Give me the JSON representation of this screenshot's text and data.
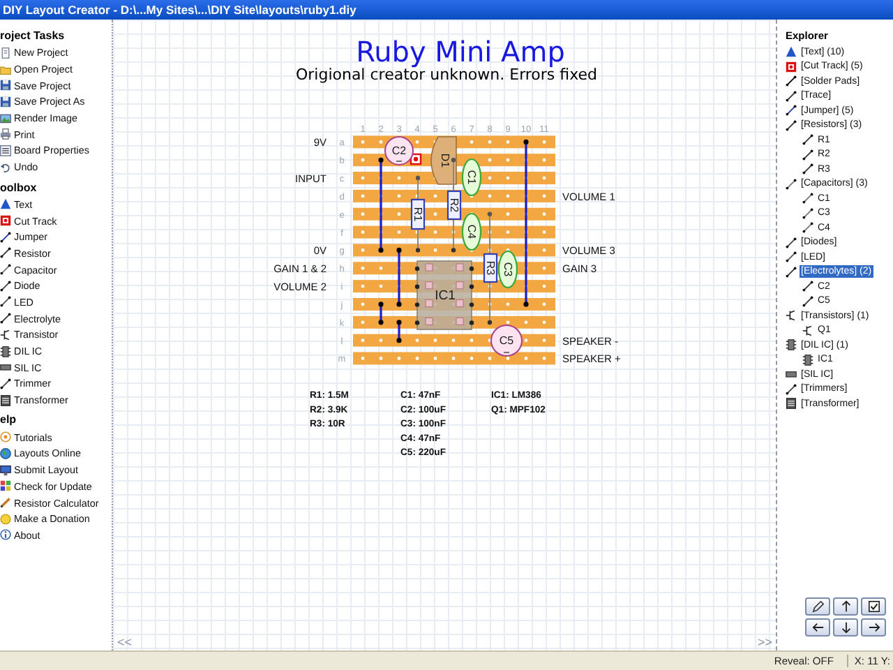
{
  "window": {
    "title": "DIY Layout Creator - D:\\...My Sites\\...\\DIY Site\\layouts\\ruby1.diy"
  },
  "sidebar": {
    "sections": [
      {
        "title": "roject Tasks",
        "items": [
          {
            "label": "New Project",
            "kind": "new"
          },
          {
            "label": "Open Project",
            "kind": "open"
          },
          {
            "label": "Save Project",
            "kind": "save"
          },
          {
            "label": "Save Project As",
            "kind": "save_as"
          },
          {
            "label": "Render Image",
            "kind": "render"
          },
          {
            "label": "Print",
            "kind": "print"
          },
          {
            "label": "Board Properties",
            "kind": "properties"
          },
          {
            "label": "Undo",
            "kind": "undo"
          }
        ]
      },
      {
        "title": "oolbox",
        "items": [
          {
            "label": "Text",
            "kind": "text"
          },
          {
            "label": "Cut Track",
            "kind": "cut_track"
          },
          {
            "label": "Jumper",
            "kind": "jumper"
          },
          {
            "label": "Resistor",
            "kind": "resistor"
          },
          {
            "label": "Capacitor",
            "kind": "capacitor"
          },
          {
            "label": "Diode",
            "kind": "diode"
          },
          {
            "label": "LED",
            "kind": "led"
          },
          {
            "label": "Electrolyte",
            "kind": "electrolyte"
          },
          {
            "label": "Transistor",
            "kind": "transistor"
          },
          {
            "label": "DIL IC",
            "kind": "dil"
          },
          {
            "label": "SIL IC",
            "kind": "sil"
          },
          {
            "label": "Trimmer",
            "kind": "trimmer"
          },
          {
            "label": "Transformer",
            "kind": "transformer"
          }
        ]
      },
      {
        "title": "elp",
        "items": [
          {
            "label": "Tutorials",
            "kind": "tutorials"
          },
          {
            "label": "Layouts Online",
            "kind": "online"
          },
          {
            "label": "Submit Layout",
            "kind": "submit"
          },
          {
            "label": "Check for Update",
            "kind": "update"
          },
          {
            "label": "Resistor Calculator",
            "kind": "calculator"
          },
          {
            "label": "Make a Donation",
            "kind": "donate"
          },
          {
            "label": "About",
            "kind": "about"
          }
        ]
      }
    ]
  },
  "board": {
    "title": "Ruby Mini Amp",
    "subtitle": "Origional creator unknown. Errors fixed",
    "columns": [
      "1",
      "2",
      "3",
      "4",
      "5",
      "6",
      "7",
      "8",
      "9",
      "10",
      "11"
    ],
    "rows": [
      "a",
      "b",
      "c",
      "d",
      "e",
      "f",
      "g",
      "h",
      "i",
      "j",
      "k",
      "l",
      "m"
    ],
    "left_labels": [
      "9V",
      "INPUT",
      "0V",
      "GAIN 1 & 2",
      "VOLUME 2"
    ],
    "right_labels": [
      "VOLUME 1",
      "VOLUME 3",
      "GAIN 3",
      "SPEAKER -",
      "SPEAKER +"
    ],
    "components": [
      {
        "kind": "electrolytic",
        "label": "C2"
      },
      {
        "kind": "diode",
        "label": "D1"
      },
      {
        "kind": "capacitor",
        "label": "C1"
      },
      {
        "kind": "resistor",
        "label": "R1"
      },
      {
        "kind": "resistor",
        "label": "R2"
      },
      {
        "kind": "capacitor",
        "label": "C4"
      },
      {
        "kind": "ic",
        "label": "IC1"
      },
      {
        "kind": "resistor",
        "label": "R3"
      },
      {
        "kind": "capacitor",
        "label": "C3"
      },
      {
        "kind": "electrolytic",
        "label": "C5"
      }
    ],
    "parts_list": [
      [
        "R1: 1.5M",
        "R2: 3.9K",
        "R3: 10R"
      ],
      [
        "C1: 47nF",
        "C2: 100uF",
        "C3: 100nF",
        "C4: 47nF",
        "C5: 220uF"
      ],
      [
        "IC1: LM386",
        "Q1: MPF102"
      ]
    ],
    "scroll_left": "<<",
    "scroll_right": ">>"
  },
  "explorer": {
    "title": "Explorer",
    "items": [
      {
        "label": "[Text] (10)",
        "kind": "text",
        "selected": false
      },
      {
        "label": "[Cut Track] (5)",
        "kind": "cut_track",
        "selected": false
      },
      {
        "label": "[Solder Pads]",
        "kind": "pads",
        "selected": false
      },
      {
        "label": "[Trace]",
        "kind": "trace",
        "selected": false
      },
      {
        "label": "[Jumper] (5)",
        "kind": "jumper",
        "selected": false
      },
      {
        "label": "[Resistors] (3)",
        "kind": "resistor",
        "selected": false,
        "children": [
          {
            "label": "R1",
            "selected": false
          },
          {
            "label": "R2",
            "selected": false
          },
          {
            "label": "R3",
            "selected": false
          }
        ]
      },
      {
        "label": "[Capacitors] (3)",
        "kind": "capacitor",
        "selected": false,
        "children": [
          {
            "label": "C1",
            "selected": false
          },
          {
            "label": "C3",
            "selected": false
          },
          {
            "label": "C4",
            "selected": false
          }
        ]
      },
      {
        "label": "[Diodes]",
        "kind": "diode",
        "selected": false
      },
      {
        "label": "[LED]",
        "kind": "led",
        "selected": false
      },
      {
        "label": "[Electrolytes] (2)",
        "kind": "electrolyte",
        "selected": true,
        "children": [
          {
            "label": "C2",
            "selected": false
          },
          {
            "label": "C5",
            "selected": false
          }
        ]
      },
      {
        "label": "[Transistors] (1)",
        "kind": "transistor",
        "selected": false,
        "children": [
          {
            "label": "Q1",
            "selected": false
          }
        ]
      },
      {
        "label": "[DIL IC] (1)",
        "kind": "dil",
        "selected": false,
        "children": [
          {
            "label": "IC1",
            "selected": false
          }
        ]
      },
      {
        "label": "[SIL IC]",
        "kind": "sil",
        "selected": false
      },
      {
        "label": "[Trimmers]",
        "kind": "trimmer",
        "selected": false
      },
      {
        "label": "[Transformer]",
        "kind": "transformer",
        "selected": false
      }
    ]
  },
  "status_bar": [
    "Reveal: OFF",
    "X: 11 Y:"
  ]
}
